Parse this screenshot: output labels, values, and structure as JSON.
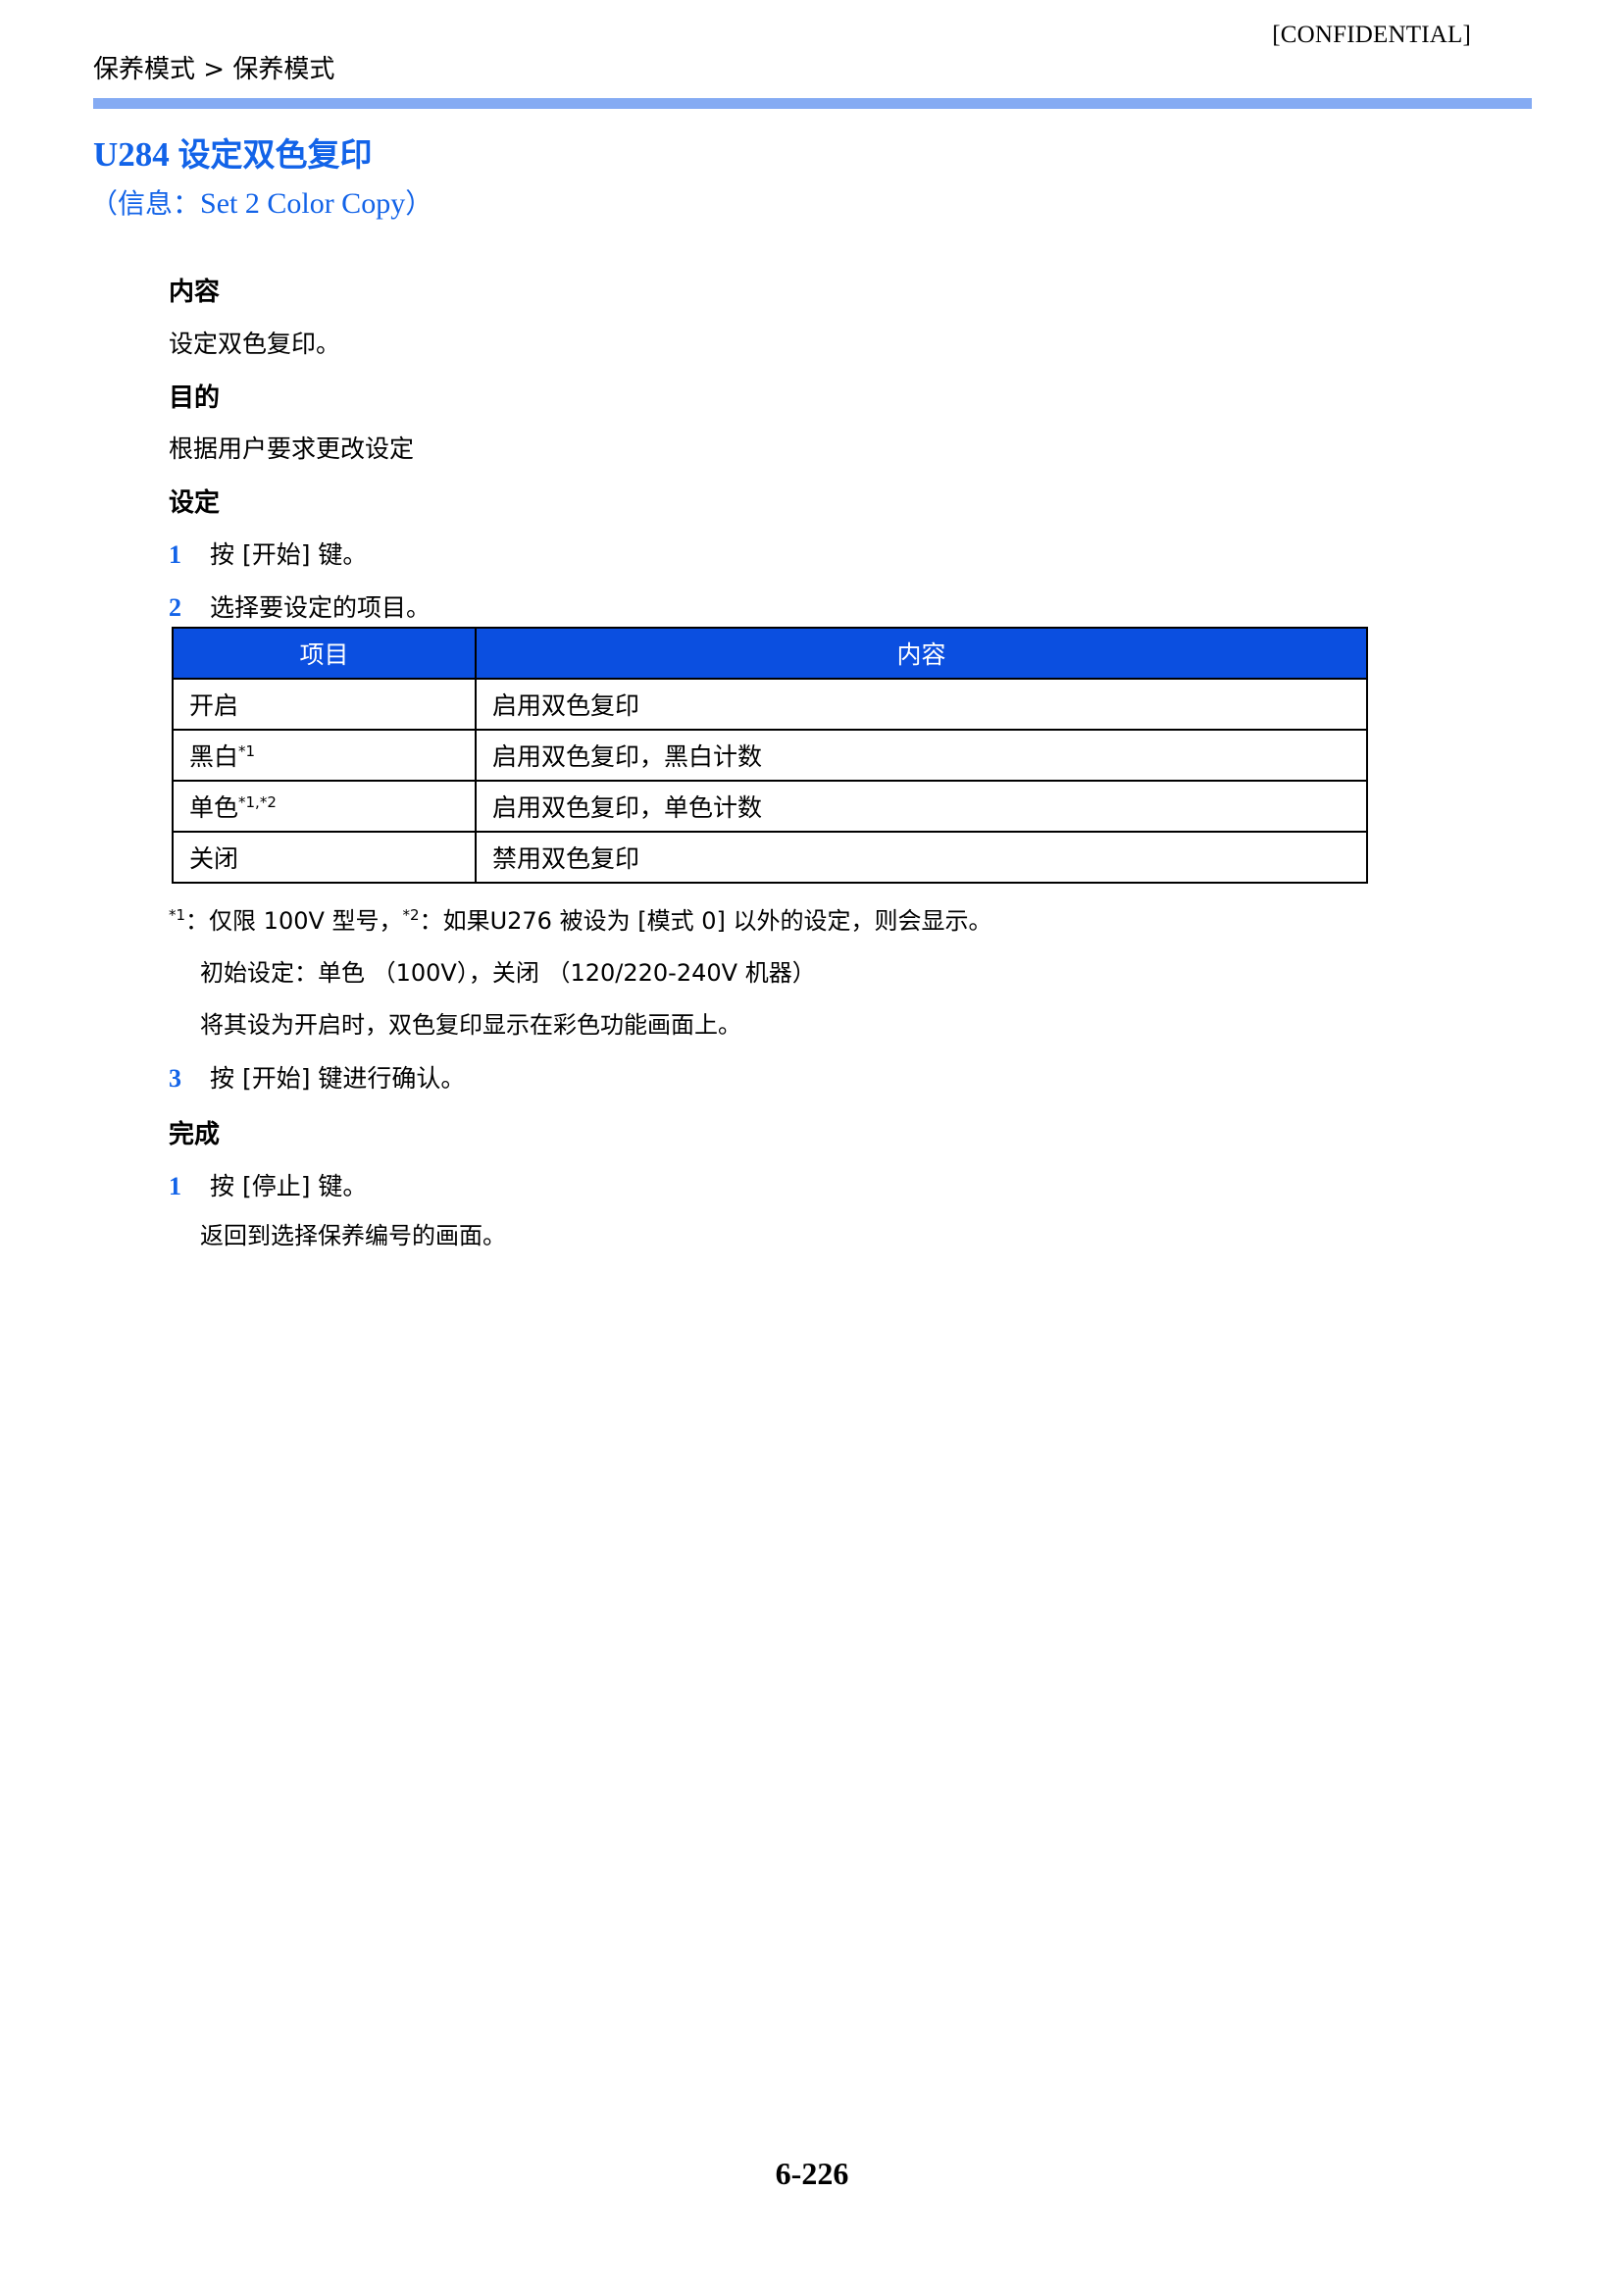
{
  "header": {
    "confidential": "[CONFIDENTIAL]",
    "breadcrumb": "保养模式 > 保养模式",
    "rule_color": "#85ABF3"
  },
  "title": {
    "code": "U284",
    "name": "设定双色复印",
    "subtitle_open": "（信息：",
    "subtitle_en": "Set 2 Color Copy",
    "subtitle_close": "）",
    "color": "#1263E8"
  },
  "sections": {
    "description_heading": "内容",
    "description_text": "设定双色复印。",
    "purpose_heading": "目的",
    "purpose_text": "根据用户要求更改设定",
    "setting_heading": "设定",
    "completion_heading": "完成"
  },
  "setting_steps": [
    {
      "num": "1",
      "text": "按 [开始] 键。"
    },
    {
      "num": "2",
      "text": "选择要设定的项目。"
    },
    {
      "num": "3",
      "text": "按 [开始] 键进行确认。"
    }
  ],
  "completion_steps": [
    {
      "num": "1",
      "text": "按 [停止] 键。"
    }
  ],
  "completion_note": "返回到选择保养编号的画面。",
  "table": {
    "headers": [
      "项目",
      "内容"
    ],
    "header_bg": "#0B4FE0",
    "rows": [
      {
        "item": "开启",
        "item_sup": "",
        "content": "启用双色复印"
      },
      {
        "item": "黑白",
        "item_sup": "*1",
        "content": "启用双色复印，黑白计数"
      },
      {
        "item": "单色",
        "item_sup": "*1,*2",
        "content": "启用双色复印，单色计数"
      },
      {
        "item": "关闭",
        "item_sup": "",
        "content": "禁用双色复印"
      }
    ]
  },
  "footnotes": {
    "line1_sup1": "*1",
    "line1_part1": "：仅限 100V 型号，",
    "line1_sup2": "*2",
    "line1_part2": "：如果U276 被设为 [模式 0] 以外的设定，则会显示。",
    "line2": "初始设定：单色 （100V），关闭 （120/220-240V 机器）",
    "line3": "将其设为开启时，双色复印显示在彩色功能画面上。"
  },
  "footer": {
    "page_number": "6-226"
  }
}
